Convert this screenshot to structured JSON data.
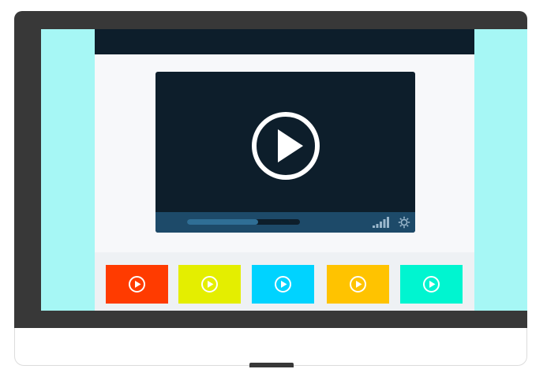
{
  "colors": {
    "accent_bezel": "#383838",
    "screen_bg": "#a6f7f5",
    "page_bg": "#f7f8fa",
    "player_bg": "#0d1e2b",
    "controls_bg": "#1d4a69",
    "progress_fill": "#2f6e95"
  },
  "player": {
    "play_icon": "play-circle-icon",
    "progress_fraction": 0.63,
    "signal_icon": "signal-bars-icon",
    "settings_icon": "gear-icon"
  },
  "thumbnails": [
    {
      "color": "#ff3b00",
      "icon": "play-circle-icon"
    },
    {
      "color": "#e4ee00",
      "icon": "play-circle-icon"
    },
    {
      "color": "#00d3ff",
      "icon": "play-circle-icon"
    },
    {
      "color": "#ffc300",
      "icon": "play-circle-icon"
    },
    {
      "color": "#00f5d0",
      "icon": "play-circle-icon"
    }
  ]
}
